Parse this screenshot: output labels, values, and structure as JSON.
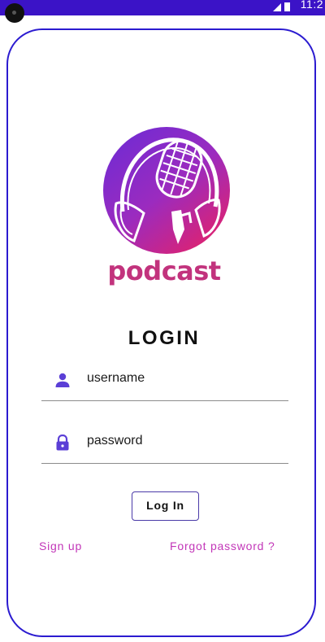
{
  "status_bar": {
    "time": "11:2",
    "color": "#3b13c7"
  },
  "brand": {
    "name": "podcast",
    "color": "#c2337d",
    "gradient": [
      "#6a2bd6",
      "#e0226e"
    ]
  },
  "login": {
    "title": "LOGIN",
    "username": {
      "value": "username",
      "icon": "person-icon"
    },
    "password": {
      "value": "password",
      "icon": "lock-icon"
    },
    "button_label": "Log In"
  },
  "links": {
    "sign_up": "Sign up",
    "forgot": "Forgot password ?"
  },
  "colors": {
    "accent": "#2b1bd0",
    "icon": "#5b3fd6",
    "link": "#c236b8"
  }
}
